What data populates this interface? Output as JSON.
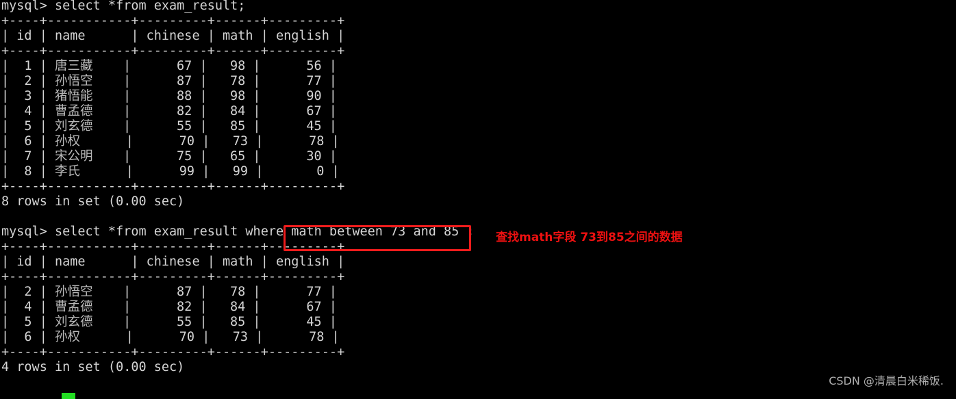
{
  "terminal": {
    "background_color": "#000000",
    "foreground_color": "#d4d4d4",
    "prompt": "mysql>",
    "lines": [
      {
        "id": "q1-prompt",
        "text": "mysql> select *from exam_result;"
      },
      {
        "id": "t1-rule-top",
        "text": "+----+-----------+---------+------+---------+"
      },
      {
        "id": "t1-header",
        "text": "| id | name      | chinese | math | english |"
      },
      {
        "id": "t1-rule-mid",
        "text": "+----+-----------+---------+------+---------+"
      },
      {
        "id": "t1-row-1",
        "text": "|  1 | 唐三藏    |      67 |   98 |      56 |"
      },
      {
        "id": "t1-row-2",
        "text": "|  2 | 孙悟空    |      87 |   78 |      77 |"
      },
      {
        "id": "t1-row-3",
        "text": "|  3 | 猪悟能    |      88 |   98 |      90 |"
      },
      {
        "id": "t1-row-4",
        "text": "|  4 | 曹孟德    |      82 |   84 |      67 |"
      },
      {
        "id": "t1-row-5",
        "text": "|  5 | 刘玄德    |      55 |   85 |      45 |"
      },
      {
        "id": "t1-row-6",
        "text": "|  6 | 孙权      |      70 |   73 |      78 |"
      },
      {
        "id": "t1-row-7",
        "text": "|  7 | 宋公明    |      75 |   65 |      30 |"
      },
      {
        "id": "t1-row-8",
        "text": "|  8 | 李氏      |      99 |   99 |       0 |"
      },
      {
        "id": "t1-rule-bot",
        "text": "+----+-----------+---------+------+---------+"
      },
      {
        "id": "t1-status",
        "text": "8 rows in set (0.00 sec)"
      },
      {
        "id": "blank-1",
        "text": ""
      },
      {
        "id": "q2-prompt",
        "text": "mysql> select *from exam_result where math between 73 and 85 ;"
      },
      {
        "id": "t2-rule-top",
        "text": "+----+-----------+---------+------+---------+"
      },
      {
        "id": "t2-header",
        "text": "| id | name      | chinese | math | english |"
      },
      {
        "id": "t2-rule-mid",
        "text": "+----+-----------+---------+------+---------+"
      },
      {
        "id": "t2-row-1",
        "text": "|  2 | 孙悟空    |      87 |   78 |      77 |"
      },
      {
        "id": "t2-row-2",
        "text": "|  4 | 曹孟德    |      82 |   84 |      67 |"
      },
      {
        "id": "t2-row-3",
        "text": "|  5 | 刘玄德    |      55 |   85 |      45 |"
      },
      {
        "id": "t2-row-4",
        "text": "|  6 | 孙权      |      70 |   73 |      78 |"
      },
      {
        "id": "t2-rule-bot",
        "text": "+----+-----------+---------+------+---------+"
      },
      {
        "id": "t2-status",
        "text": "4 rows in set (0.00 sec)"
      }
    ]
  },
  "queries": {
    "first": {
      "full_text": "select *from exam_result;",
      "statement": "select *from exam_result;"
    },
    "second": {
      "full_text": "select *from exam_result where math between 73 and 85 ;",
      "prefix": "select *from exam_result where ",
      "highlighted_clause": "math between 73 and 85 ;"
    }
  },
  "result_tables": [
    {
      "name": "exam_result-full",
      "columns": [
        "id",
        "name",
        "chinese",
        "math",
        "english"
      ],
      "rows": [
        [
          "1",
          "唐三藏",
          "67",
          "98",
          "56"
        ],
        [
          "2",
          "孙悟空",
          "87",
          "78",
          "77"
        ],
        [
          "3",
          "猪悟能",
          "88",
          "98",
          "90"
        ],
        [
          "4",
          "曹孟德",
          "82",
          "84",
          "67"
        ],
        [
          "5",
          "刘玄德",
          "55",
          "85",
          "45"
        ],
        [
          "6",
          "孙权",
          "70",
          "73",
          "78"
        ],
        [
          "7",
          "宋公明",
          "75",
          "65",
          "30"
        ],
        [
          "8",
          "李氏",
          "99",
          "99",
          "0"
        ]
      ],
      "status": "8 rows in set (0.00 sec)"
    },
    {
      "name": "exam_result-between-73-85",
      "columns": [
        "id",
        "name",
        "chinese",
        "math",
        "english"
      ],
      "rows": [
        [
          "2",
          "孙悟空",
          "87",
          "78",
          "77"
        ],
        [
          "4",
          "曹孟德",
          "82",
          "84",
          "67"
        ],
        [
          "5",
          "刘玄德",
          "55",
          "85",
          "45"
        ],
        [
          "6",
          "孙权",
          "70",
          "73",
          "78"
        ]
      ],
      "status": "4 rows in set (0.00 sec)"
    }
  ],
  "annotation": {
    "text": "查找math字段 73到85之间的数据",
    "color": "#ee1111"
  },
  "highlight_box": {
    "color": "#f01c1c",
    "encloses": "math between 73 and 85 ;"
  },
  "cursor": {
    "color": "#22dd22",
    "shape": "block"
  },
  "watermark": {
    "text": "CSDN @清晨白米稀饭."
  }
}
